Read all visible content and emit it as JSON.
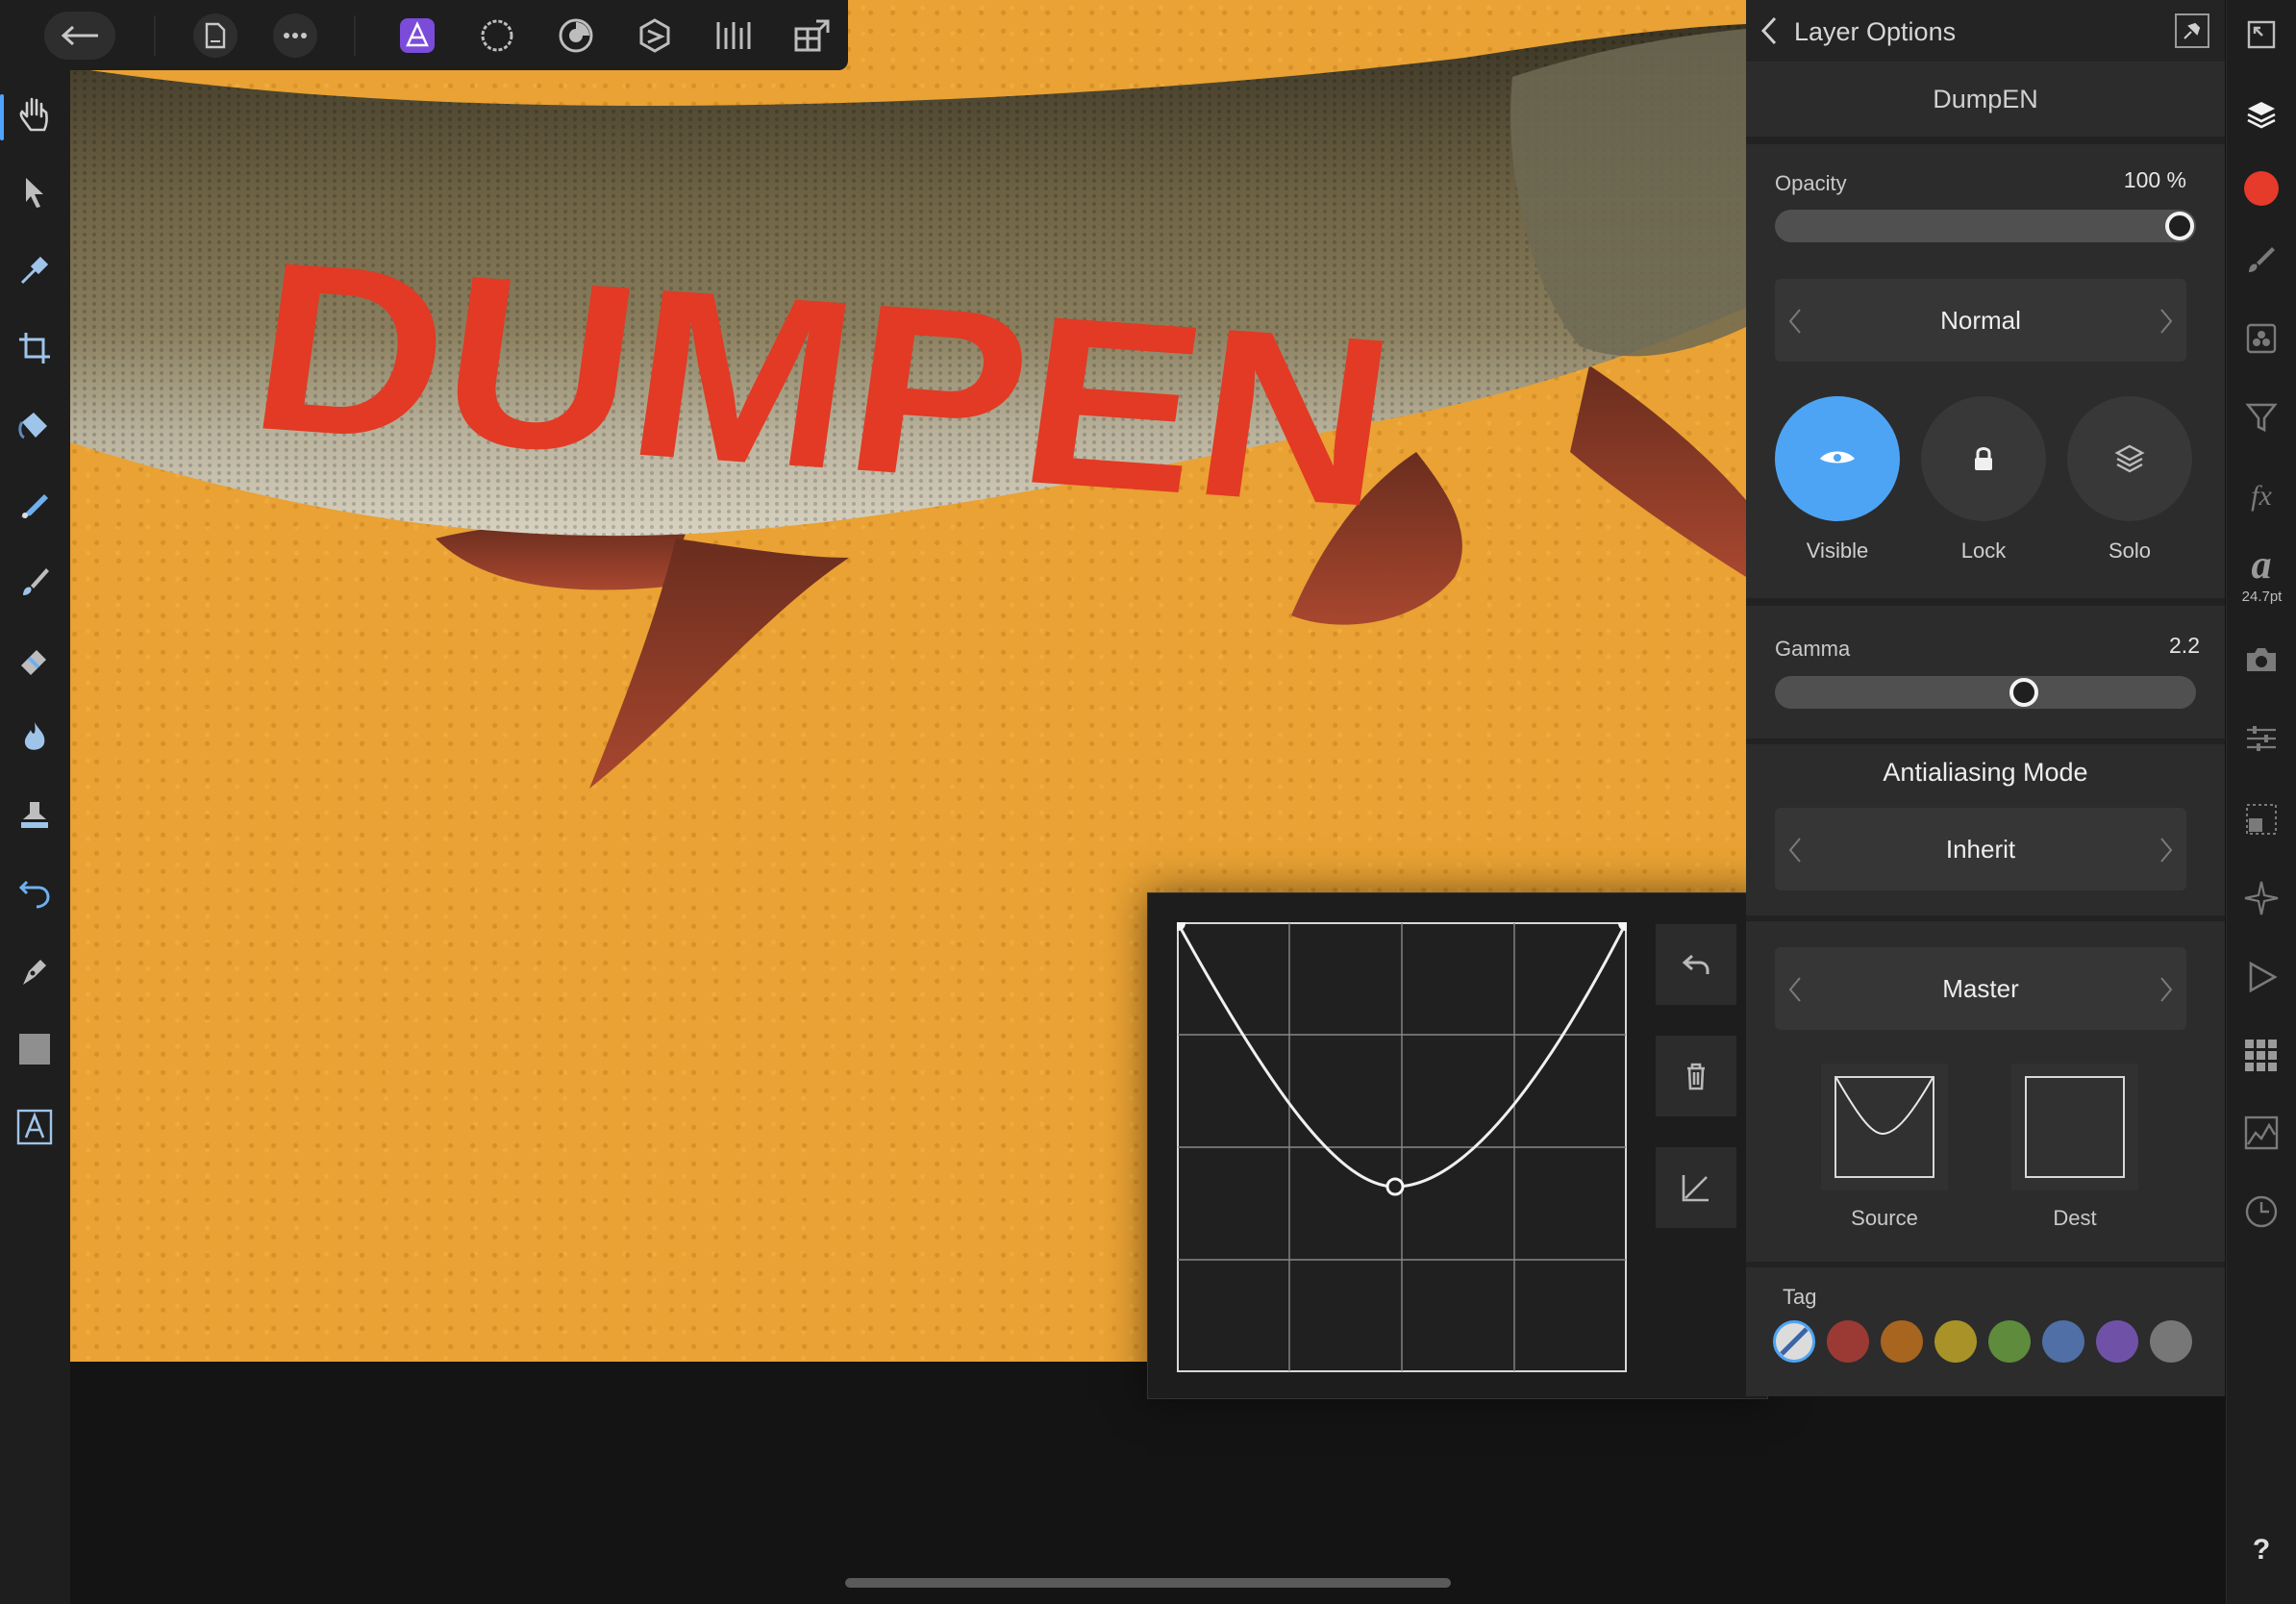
{
  "canvas": {
    "artwork_text": "DUMPEN",
    "background_color": "#e9a233",
    "text_color": "#e23a24"
  },
  "top_toolbar": {
    "back_icon": "arrow-left-icon",
    "icons": [
      "document-icon",
      "more-icon",
      "photo-persona-icon",
      "liquify-persona-icon",
      "develop-persona-icon",
      "tone-map-persona-icon",
      "export-persona-icon",
      "assistant-icon"
    ]
  },
  "left_toolbar": {
    "tools": [
      "view-tool",
      "move-tool",
      "color-picker-tool",
      "crop-tool",
      "flood-fill-tool",
      "selection-brush-tool",
      "paint-brush-tool",
      "erase-brush-tool",
      "dodge-burn-tool",
      "clone-tool",
      "undo-brush-tool",
      "pen-tool",
      "rectangle-tool",
      "text-tool"
    ]
  },
  "layer_panel": {
    "title": "Layer Options",
    "layer_name": "DumpEN",
    "opacity_label": "Opacity",
    "opacity_value": "100 %",
    "opacity_level": 1.0,
    "blend_mode": "Normal",
    "visible_label": "Visible",
    "lock_label": "Lock",
    "solo_label": "Solo",
    "visible_on": true,
    "gamma_label": "Gamma",
    "gamma_value": "2.2",
    "gamma_level": 0.6,
    "antialiasing_title": "Antialiasing Mode",
    "antialiasing_value": "Inherit",
    "channel": "Master",
    "source_label": "Source",
    "dest_label": "Dest",
    "tag_label": "Tag",
    "tag_colors": [
      "none",
      "#9b3a34",
      "#a86520",
      "#a99328",
      "#5f8b3d",
      "#4f6fa6",
      "#6f52a8",
      "#777777"
    ]
  },
  "curve_popover": {
    "curve_points": [
      [
        0,
        1
      ],
      [
        0.5,
        0
      ],
      [
        1,
        1
      ]
    ],
    "buttons": [
      "reset-icon",
      "delete-icon",
      "linear-curve-icon"
    ]
  },
  "studio_bar": {
    "icons": [
      "fullscreen-icon",
      "layers-icon",
      "color-icon",
      "brushes-icon",
      "channels-icon",
      "adjustments-icon",
      "fx-icon",
      "text-styles-icon",
      "snapshots-icon",
      "transform-icon",
      "navigator-icon",
      "stock-icon",
      "macro-icon",
      "swatches-icon",
      "histogram-icon",
      "history-icon",
      "help-icon"
    ],
    "color_swatch": "#e63a2a",
    "font_size": "24.7pt",
    "fx_label": "fx",
    "text_style_glyph": "a",
    "help_label": "?"
  }
}
